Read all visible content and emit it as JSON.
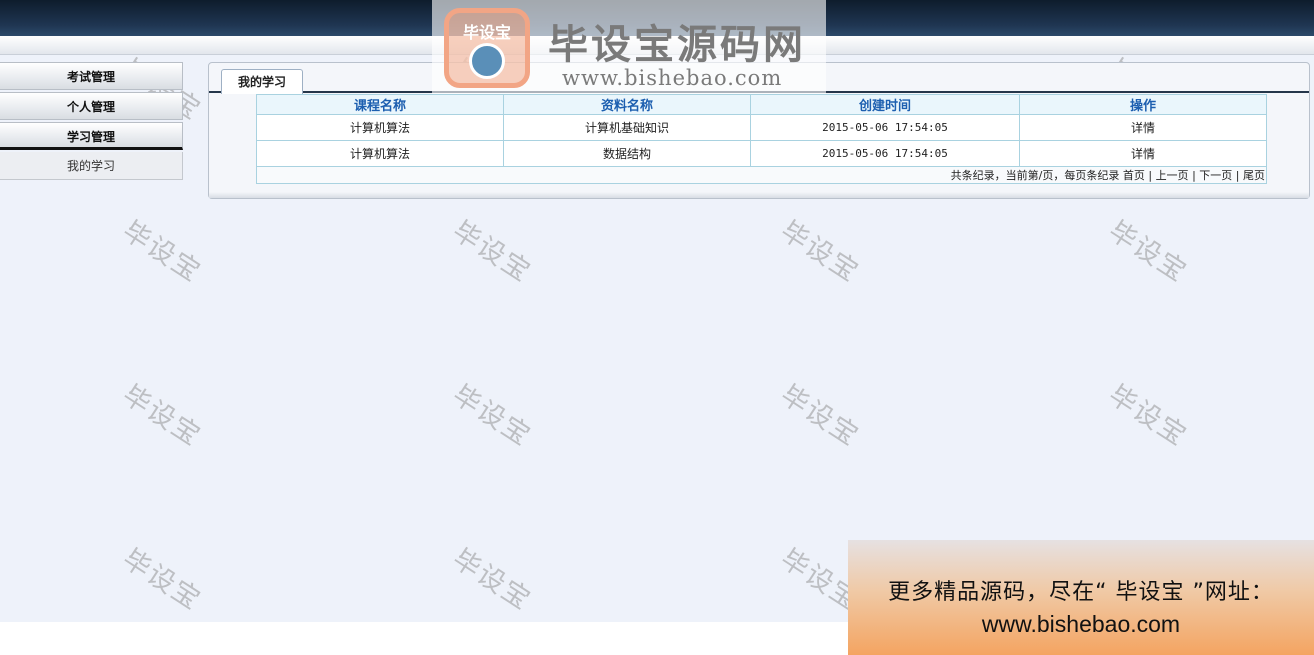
{
  "logo": {
    "badge_text": "毕设宝",
    "title": "毕设宝源码网",
    "url": "www.bishebao.com"
  },
  "sidebar": {
    "items": [
      {
        "label": "考试管理"
      },
      {
        "label": "个人管理"
      },
      {
        "label": "学习管理"
      }
    ],
    "sub_items": [
      {
        "label": "我的学习"
      }
    ]
  },
  "main": {
    "tab_label": "我的学习",
    "columns": [
      "课程名称",
      "资料名称",
      "创建时间",
      "操作"
    ],
    "rows": [
      {
        "course": "计算机算法",
        "material": "计算机基础知识",
        "created": "2015-05-06 17:54:05",
        "action": "详情"
      },
      {
        "course": "计算机算法",
        "material": "数据结构",
        "created": "2015-05-06 17:54:05",
        "action": "详情"
      }
    ],
    "pager": {
      "summary": "共条纪录，当前第/页，每页条纪录",
      "first": "首页",
      "prev": "上一页",
      "next": "下一页",
      "last": "尾页",
      "separator": "|"
    }
  },
  "watermark": "毕设宝",
  "ad": {
    "line1": "更多精品源码，尽在“ 毕设宝 ”网址：",
    "line2": "www.bishebao.com"
  },
  "colors": {
    "header_dark": "#1f3652",
    "table_header_text": "#1d5fb0",
    "table_border": "#a9d2e0",
    "page_background": "#eef2fa"
  }
}
